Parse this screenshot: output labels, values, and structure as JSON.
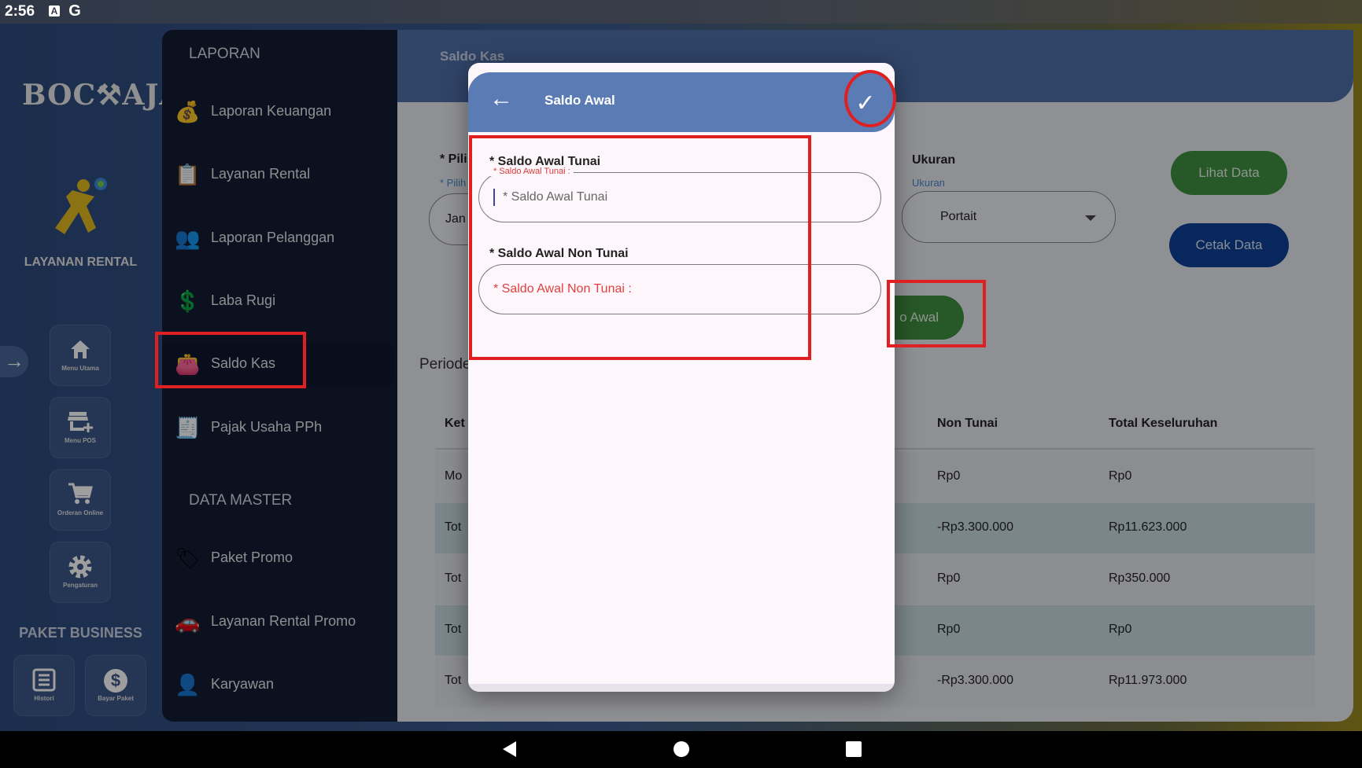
{
  "status_bar": {
    "time": "2:56",
    "icons": [
      "a-icon",
      "google-icon"
    ]
  },
  "rail": {
    "logo": "BOC⚒AJA",
    "app_title": "LAYANAN RENTAL",
    "buttons": [
      {
        "label": "Menu Utama",
        "icon": "home-icon"
      },
      {
        "label": "Menu POS",
        "icon": "store-icon"
      },
      {
        "label": "Orderan Online",
        "icon": "cart-icon"
      },
      {
        "label": "Pengaturan",
        "icon": "gear-icon"
      }
    ],
    "paket_title": "PAKET BUSINESS",
    "small_buttons": [
      {
        "label": "Histori",
        "icon": "list-icon"
      },
      {
        "label": "Bayar Paket",
        "icon": "dollar-icon"
      }
    ]
  },
  "sidebar": {
    "section_laporan": "LAPORAN",
    "laporan_items": [
      {
        "label": "Laporan Keuangan",
        "icon": "money-bag-icon"
      },
      {
        "label": "Layanan Rental",
        "icon": "clipboard-icon"
      },
      {
        "label": "Laporan Pelanggan",
        "icon": "people-icon"
      },
      {
        "label": "Laba Rugi",
        "icon": "coins-icon"
      },
      {
        "label": "Saldo Kas",
        "icon": "wallet-icon"
      },
      {
        "label": "Pajak Usaha PPh",
        "icon": "tax-icon"
      }
    ],
    "section_master": "DATA MASTER",
    "master_items": [
      {
        "label": "Paket Promo",
        "icon": "tag-icon"
      },
      {
        "label": "Layanan Rental Promo",
        "icon": "car-icon"
      },
      {
        "label": "Karyawan",
        "icon": "person-icon"
      }
    ]
  },
  "main": {
    "header_title": "Saldo Kas",
    "pilih_label": "* Pili",
    "pilih_sub": "* Pilih",
    "pilih_value": "Jan",
    "ukuran_label": "Ukuran",
    "ukuran_sub": "Ukuran",
    "ukuran_value": "Portait",
    "lihat_button": "Lihat Data",
    "cetak_button": "Cetak Data",
    "saldo_awal_button": "o Awal",
    "periode_label": "Periode",
    "table_headers": {
      "ket": "Ket",
      "non_tunai": "Non Tunai",
      "total": "Total Keseluruhan"
    },
    "rows": [
      {
        "ket": "Mo",
        "non_tunai": "Rp0",
        "total": "Rp0"
      },
      {
        "ket": "Tot",
        "non_tunai": "-Rp3.300.000",
        "total": "Rp11.623.000"
      },
      {
        "ket": "Tot",
        "non_tunai": "Rp0",
        "total": "Rp350.000"
      },
      {
        "ket": "Tot",
        "non_tunai": "Rp0",
        "total": "Rp0"
      },
      {
        "ket": "Tot",
        "non_tunai": "-Rp3.300.000",
        "total": "Rp11.973.000"
      }
    ]
  },
  "dialog": {
    "title": "Saldo Awal",
    "tunai_label": "* Saldo Awal Tunai",
    "tunai_float": "* Saldo Awal Tunai :",
    "tunai_placeholder": "* Saldo Awal Tunai",
    "non_tunai_label": "* Saldo Awal Non Tunai",
    "non_tunai_placeholder": "* Saldo Awal Non Tunai :"
  },
  "colors": {
    "accent": "#5b7bb4",
    "sidebar_bg": "#141c34",
    "green": "#3f8f3f",
    "blue": "#0d3f96",
    "annotation_red": "#e02020"
  }
}
